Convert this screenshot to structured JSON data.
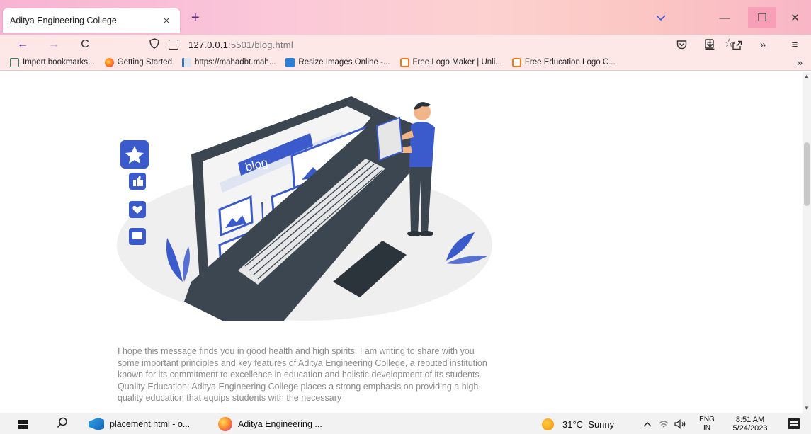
{
  "browser": {
    "tab_title": "Aditya Engineering College",
    "tab_close": "×",
    "new_tab": "+",
    "list_tabs_icon": "chevron-down-icon",
    "window_controls": {
      "minimize": "—",
      "maximize": "❐",
      "close": "✕"
    }
  },
  "navbar": {
    "back": "←",
    "forward": "→",
    "reload": "C",
    "url_host": "127.0.0.1",
    "url_rest": ":5501/blog.html",
    "icons": [
      "shield-icon",
      "page-icon",
      "reader-view-icon",
      "bookmark-star-icon",
      "pocket-icon",
      "download-icon",
      "share-icon",
      "overflow-icon",
      "menu-icon"
    ]
  },
  "bookmarks": [
    {
      "label": "Import bookmarks...",
      "icon": "import-icon"
    },
    {
      "label": "Getting Started",
      "icon": "firefox-icon"
    },
    {
      "label": "https://mahadbt.mah...",
      "icon": "document-icon"
    },
    {
      "label": "Resize Images Online -...",
      "icon": "resize-icon"
    },
    {
      "label": "Free Logo Maker | Unli...",
      "icon": "logo-icon"
    },
    {
      "label": "Free Education Logo C...",
      "icon": "logo-icon"
    }
  ],
  "bookmarks_more": "»",
  "hero": {
    "screen_text": "blog",
    "colors": {
      "accent": "#3b5bcc",
      "laptop": "#3b4651",
      "floor": "#efefef",
      "skin": "#f2b58a"
    }
  },
  "article": {
    "text": "I hope this message finds you in good health and high spirits. I am writing to share with you some important principles and key features of Aditya Engineering College, a reputed institution known for its commitment to excellence in education and holistic development of its students. Quality Education: Aditya Engineering College places a strong emphasis on providing a high-quality education that equips students with the necessary"
  },
  "taskbar": {
    "apps": [
      {
        "label": "placement.html - o...",
        "icon": "vscode-icon"
      },
      {
        "label": "Aditya Engineering ...",
        "icon": "firefox-icon"
      }
    ],
    "weather": "31°C  Sunny",
    "tray_up": "^",
    "lang_top": "ENG",
    "lang_bottom": "IN",
    "time": "8:51 AM",
    "date": "5/24/2023"
  }
}
